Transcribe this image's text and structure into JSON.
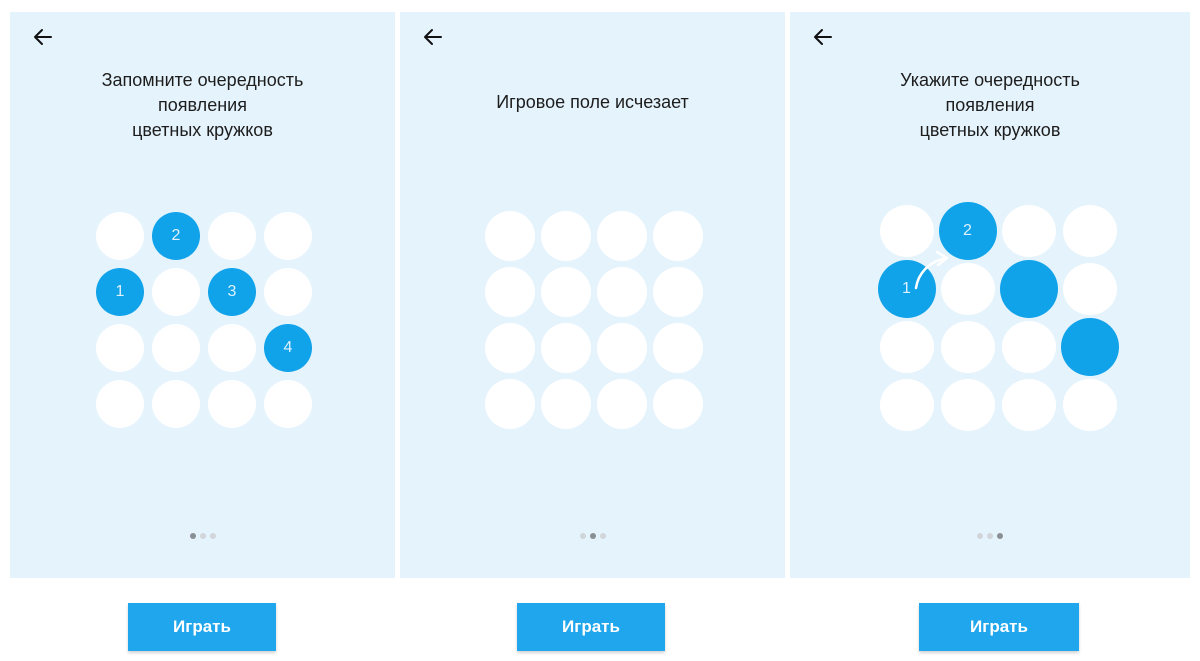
{
  "colors": {
    "panel_bg": "#e5f3fc",
    "accent": "#10a3ea",
    "button": "#20a6ec",
    "circle_empty": "#ffffff",
    "dot_active": "#8a8f94",
    "dot_inactive": "#d0d5da"
  },
  "screens": [
    {
      "back_icon": "arrow-left-icon",
      "title": "Запомните очередность\nпоявления\nцветных кружков",
      "grid": [
        [
          "",
          "2",
          "",
          ""
        ],
        [
          "1",
          "",
          "3",
          ""
        ],
        [
          "",
          "",
          "",
          "4"
        ],
        [
          "",
          "",
          "",
          ""
        ]
      ],
      "active_page": 1,
      "pages": 3,
      "button_label": "Играть"
    },
    {
      "back_icon": "arrow-left-icon",
      "title": "Игровое поле исчезает",
      "grid": [
        [
          "",
          "",
          "",
          ""
        ],
        [
          "",
          "",
          "",
          ""
        ],
        [
          "",
          "",
          "",
          ""
        ],
        [
          "",
          "",
          "",
          ""
        ]
      ],
      "active_page": 2,
      "pages": 3,
      "button_label": "Играть"
    },
    {
      "back_icon": "arrow-left-icon",
      "title": "Укажите очередность\nпоявления\nцветных кружков",
      "grid": [
        [
          "",
          "2",
          "",
          ""
        ],
        [
          "1",
          "",
          "filled",
          ""
        ],
        [
          "",
          "",
          "",
          "filled"
        ],
        [
          "",
          "",
          "",
          ""
        ]
      ],
      "arrow_icon": "curved-arrow-icon",
      "active_page": 3,
      "pages": 3,
      "button_label": "Играть"
    }
  ]
}
